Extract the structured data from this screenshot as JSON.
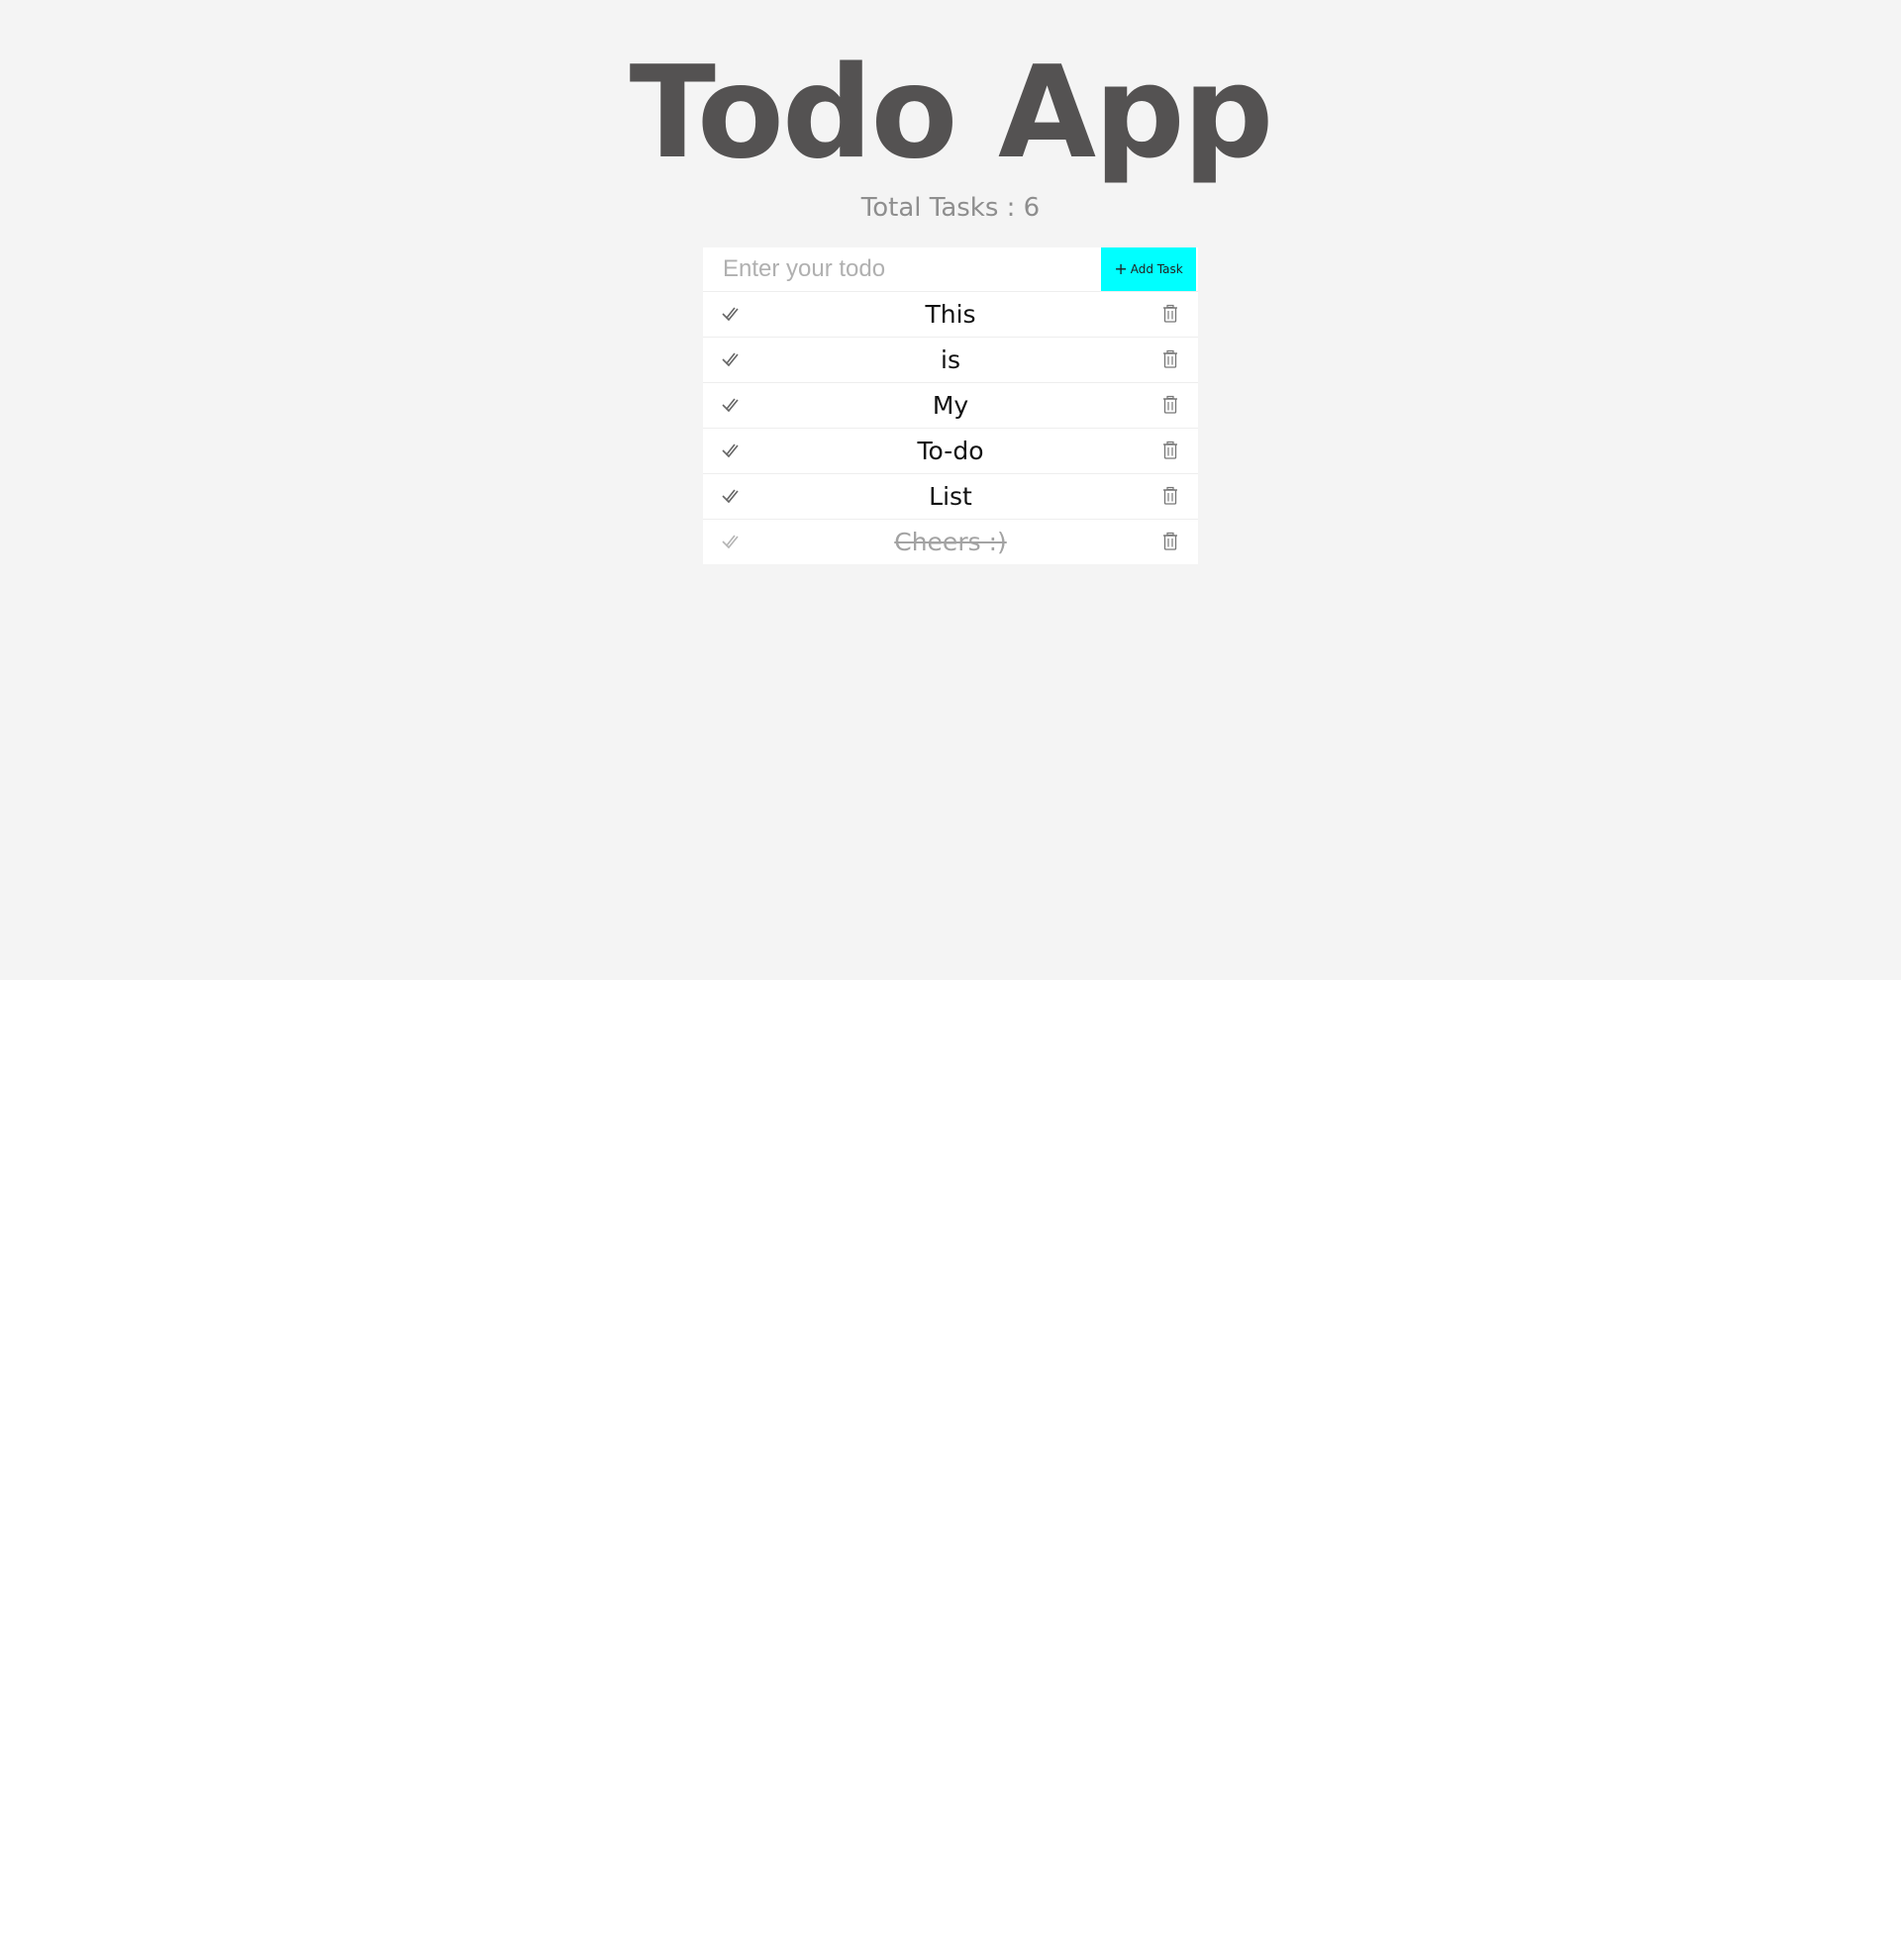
{
  "app": {
    "title": "Todo App",
    "total_label": "Total Tasks : 6"
  },
  "input": {
    "placeholder": "Enter your todo",
    "value": ""
  },
  "add_button": {
    "label": "Add Task",
    "icon": "plus-icon",
    "color": "#00ffff"
  },
  "todos": [
    {
      "text": "This",
      "done": false
    },
    {
      "text": "is",
      "done": false
    },
    {
      "text": "My",
      "done": false
    },
    {
      "text": "To-do",
      "done": false
    },
    {
      "text": "List",
      "done": false
    },
    {
      "text": "Cheers :)",
      "done": true
    }
  ],
  "icons": {
    "check": "double-check-icon",
    "delete": "trash-icon"
  },
  "colors": {
    "background": "#f4f4f4",
    "title": "#545252",
    "accent": "#00ffff"
  }
}
